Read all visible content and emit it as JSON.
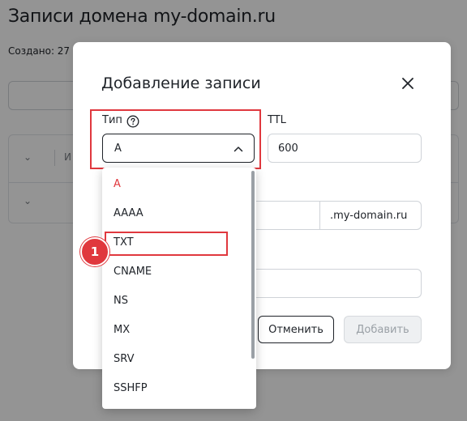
{
  "page": {
    "title": "Записи домена my-domain.ru",
    "created_label": "Создано: 27",
    "table_col_label": "И"
  },
  "modal": {
    "title": "Добавление записи",
    "type_label": "Тип",
    "type_value": "A",
    "ttl_label": "TTL",
    "ttl_value": "600",
    "domain_suffix": ".my-domain.ru",
    "cancel_label": "Отменить",
    "add_label": "Добавить"
  },
  "dropdown": {
    "items": [
      "A",
      "AAAA",
      "TXT",
      "CNAME",
      "NS",
      "MX",
      "SRV",
      "SSHFP"
    ],
    "selected": "A"
  },
  "annotation": {
    "step_number": "1"
  },
  "colors": {
    "accent_red": "#e0383e",
    "text": "#1f2329",
    "border": "#cfd3d8"
  }
}
